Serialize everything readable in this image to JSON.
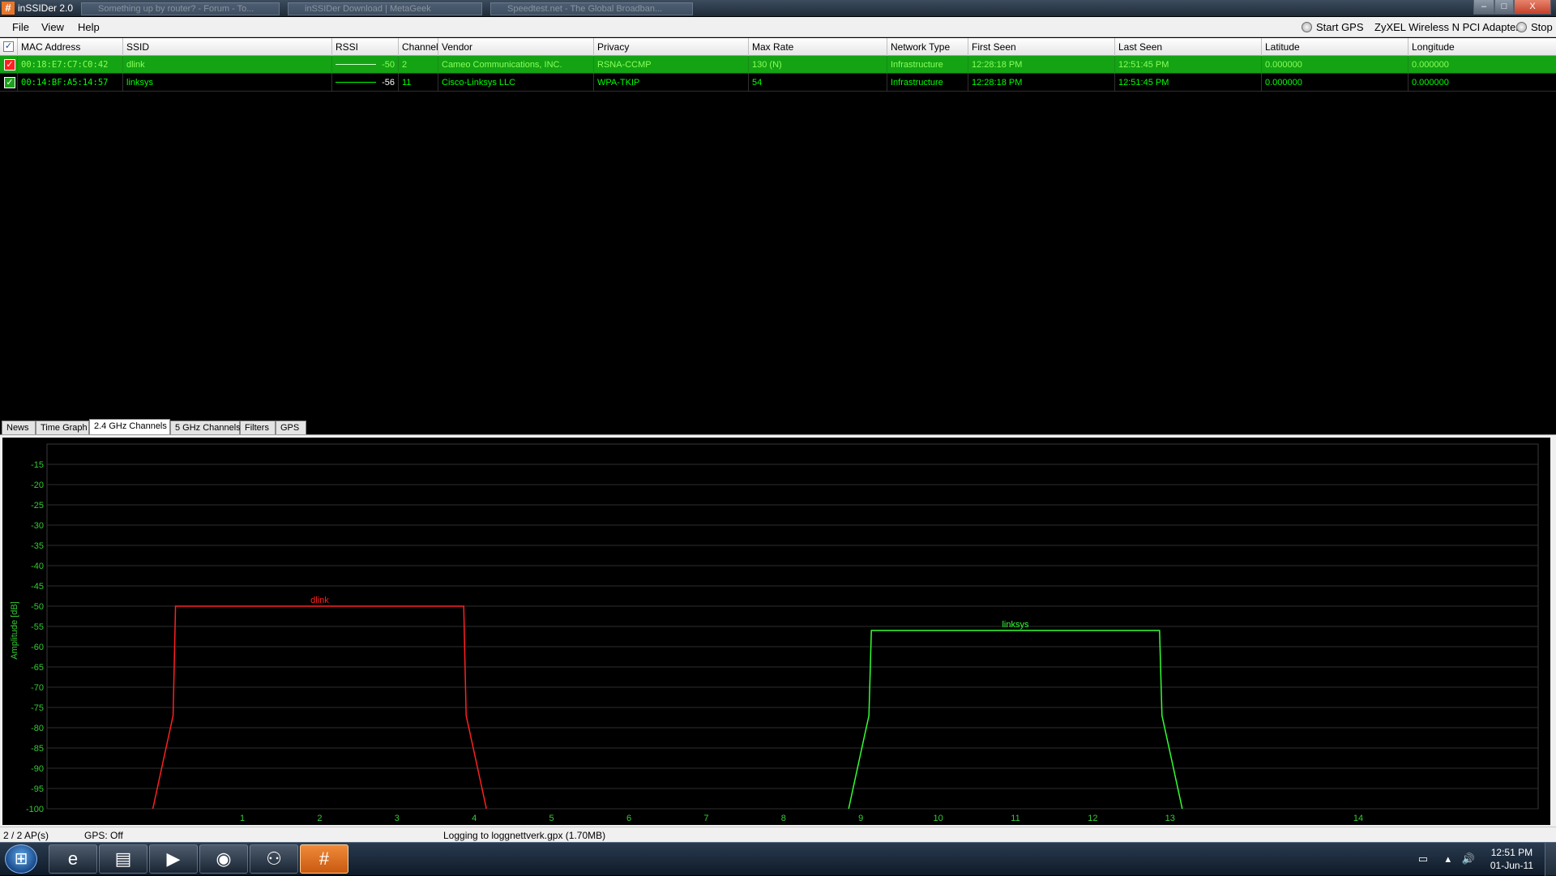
{
  "window": {
    "app_icon": "#",
    "title": "inSSIDer 2.0",
    "background_tabs": [
      "Something up by router? - Forum - To...",
      "inSSIDer Download | MetaGeek",
      "Speedtest.net - The Global Broadban..."
    ],
    "controls": {
      "minimize": "–",
      "maximize": "□",
      "close": "X"
    }
  },
  "menu": {
    "items": [
      "File",
      "View",
      "Help"
    ],
    "start_gps": "Start GPS",
    "adapter": "ZyXEL Wireless N PCI Adapter",
    "stop": "Stop"
  },
  "table": {
    "columns": [
      "MAC Address",
      "SSID",
      "RSSI",
      "Channel",
      "Vendor",
      "Privacy",
      "Max Rate",
      "Network Type",
      "First Seen",
      "Last Seen",
      "Latitude",
      "Longitude"
    ],
    "rows": [
      {
        "check": "✓",
        "color": "#ff2020",
        "mac": "00:18:E7:C7:C0:42",
        "ssid": "dlink",
        "rssi": "-50",
        "channel": "2",
        "vendor": "Cameo Communications, INC.",
        "privacy": "RSNA-CCMP",
        "max_rate": "130 (N)",
        "network_type": "Infrastructure",
        "first_seen": "12:28:18 PM",
        "last_seen": "12:51:45 PM",
        "latitude": "0.000000",
        "longitude": "0.000000"
      },
      {
        "check": "✓",
        "color": "#33ff33",
        "mac": "00:14:BF:A5:14:57",
        "ssid": "linksys",
        "rssi": "-56",
        "channel": "11",
        "vendor": "Cisco-Linksys LLC",
        "privacy": "WPA-TKIP",
        "max_rate": "54",
        "network_type": "Infrastructure",
        "first_seen": "12:28:18 PM",
        "last_seen": "12:51:45 PM",
        "latitude": "0.000000",
        "longitude": "0.000000"
      }
    ]
  },
  "tabs": {
    "items": [
      "News",
      "Time Graph",
      "2.4 GHz Channels",
      "5 GHz Channels",
      "Filters",
      "GPS"
    ],
    "active": "2.4 GHz Channels"
  },
  "chart_data": {
    "type": "line",
    "title": "",
    "xlabel": "",
    "ylabel": "Amplitude [dB]",
    "x_ticks": [
      "1",
      "2",
      "3",
      "4",
      "5",
      "6",
      "7",
      "8",
      "9",
      "10",
      "11",
      "12",
      "13",
      "14"
    ],
    "y_ticks": [
      "-15",
      "-20",
      "-25",
      "-30",
      "-35",
      "-40",
      "-45",
      "-50",
      "-55",
      "-60",
      "-65",
      "-70",
      "-75",
      "-80",
      "-85",
      "-90",
      "-95",
      "-100"
    ],
    "ylim": [
      -100,
      -10
    ],
    "grid": true,
    "series": [
      {
        "name": "dlink",
        "color": "#ff2020",
        "channel": 2,
        "amplitude": -50
      },
      {
        "name": "linksys",
        "color": "#33ff33",
        "channel": 11,
        "amplitude": -56
      }
    ]
  },
  "status": {
    "ap_count": "2 / 2 AP(s)",
    "gps": "GPS: Off",
    "logging": "Logging to loggnettverk.gpx (1.70MB)"
  },
  "taskbar": {
    "start_icon": "⊞",
    "apps": [
      {
        "name": "ie",
        "glyph": "e"
      },
      {
        "name": "explorer",
        "glyph": "▤"
      },
      {
        "name": "media-player",
        "glyph": "▶"
      },
      {
        "name": "firefox",
        "glyph": "◉"
      },
      {
        "name": "network",
        "glyph": "⚇"
      },
      {
        "name": "inssider",
        "glyph": "#"
      }
    ],
    "tray_icons": [
      "▭",
      "▴",
      "🔊"
    ],
    "time": "12:51 PM",
    "date": "01-Jun-11"
  }
}
